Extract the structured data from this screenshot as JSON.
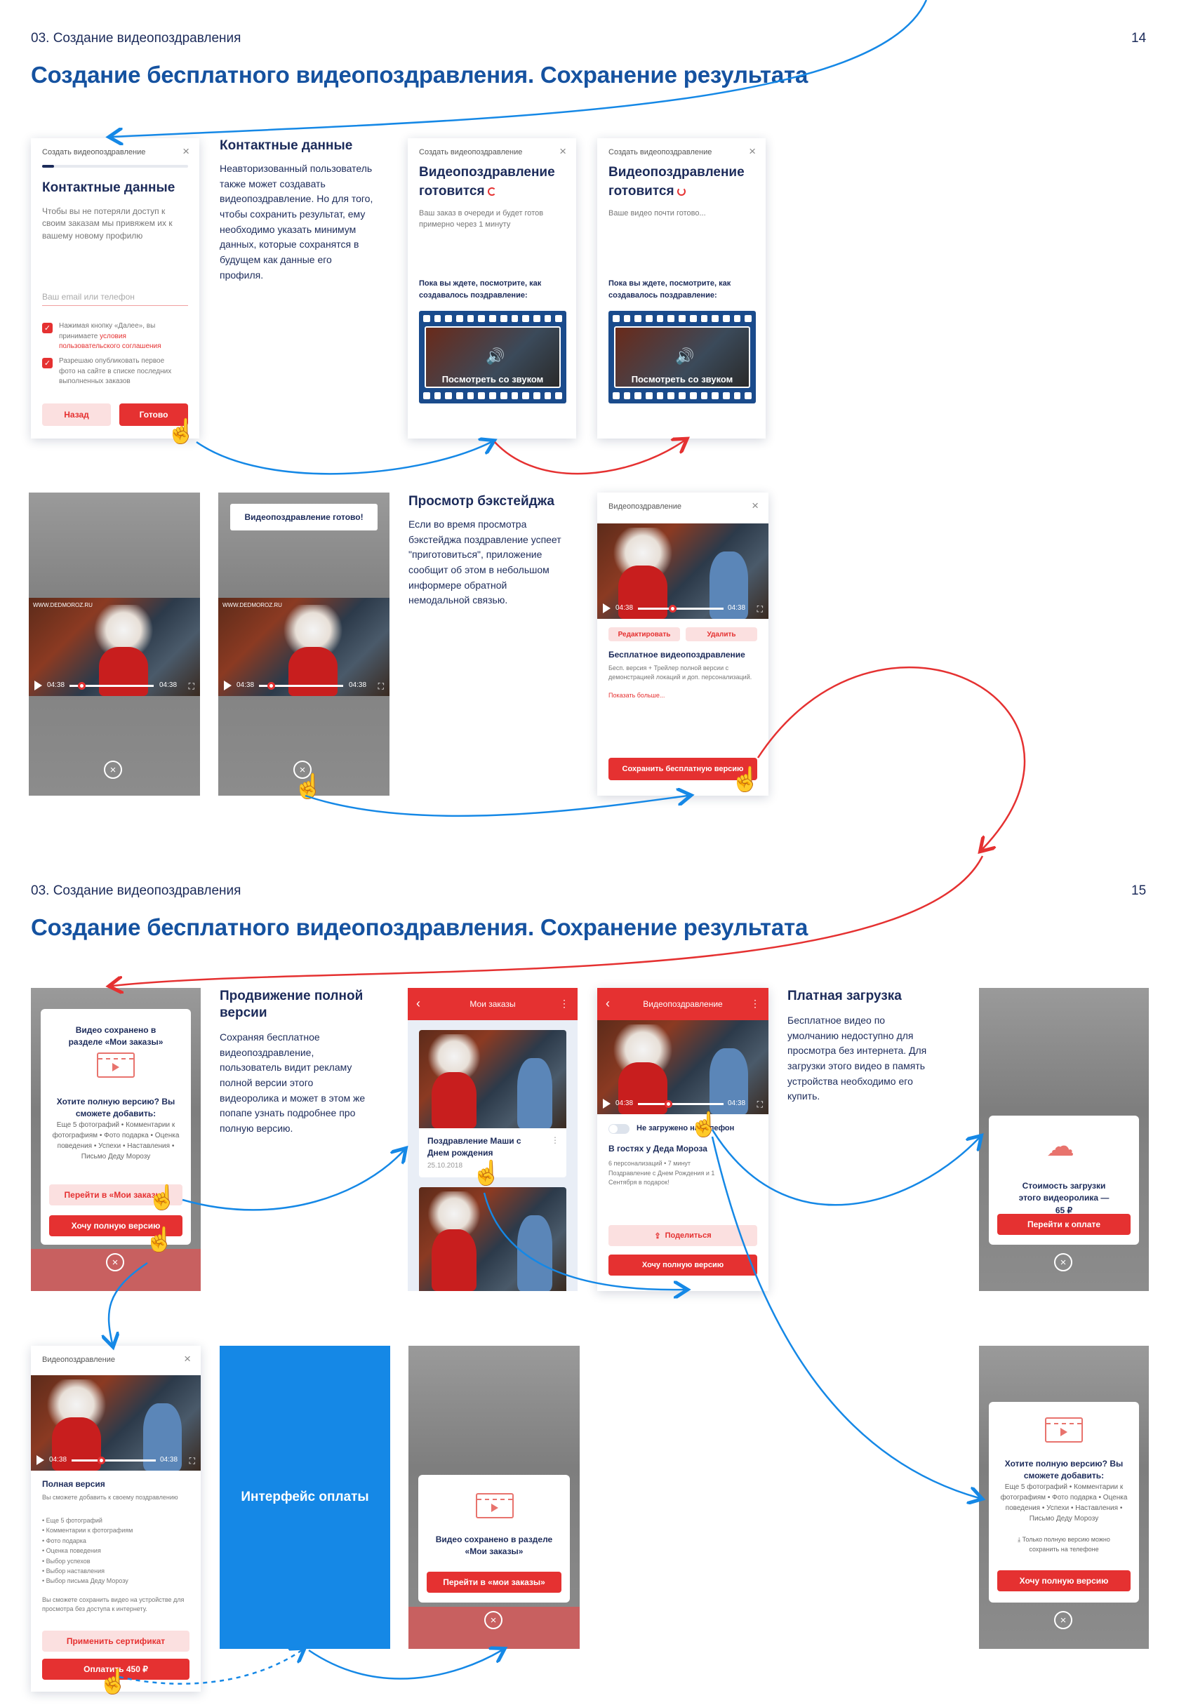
{
  "page14": {
    "breadcrumb": "03. Создание видеопоздравления",
    "page_number": "14",
    "title": "Создание бесплатного видеопоздравления. Сохранение результата"
  },
  "page15": {
    "breadcrumb": "03. Создание видеопоздравления",
    "page_number": "15",
    "title": "Создание бесплатного видеопоздравления. Сохранение результата"
  },
  "contacts_screen": {
    "header": "Создать видеопоздравление",
    "close": "×",
    "progress": 0.08,
    "title": "Контактные данные",
    "subtitle": "Чтобы вы не потеряли доступ к своим заказам мы привяжем их к вашему новому профилю",
    "input_placeholder": "Ваш email или телефон",
    "check1_text": "Нажимая кнопку «Далее», вы принимаете",
    "check1_link": "условия пользовательского соглашения",
    "check2_text": "Разрешаю опубликовать первое фото на сайте в списке последних выполненных заказов",
    "back_button": "Назад",
    "done_button": "Готово"
  },
  "contacts_annotation": {
    "title": "Контактные данные",
    "text": "Неавторизованный пользователь также может создавать видеопоздравление. Но для того, чтобы сохранить результат, ему необходимо указать минимум данных, которые сохранятся в будущем как данные его профиля."
  },
  "preparing1": {
    "header": "Создать видеопоздравление",
    "close": "×",
    "title": "Видеопоздравление готовится",
    "subtitle": "Ваш заказ в очереди и будет готов примерно через 1 минуту",
    "watch_label": "Пока вы ждете, посмотрите, как создавалось поздравление:",
    "film_text": "Посмотреть со звуком"
  },
  "preparing2": {
    "header": "Создать видеопоздравление",
    "close": "×",
    "title": "Видеопоздравление готовится",
    "subtitle": "Ваше видео почти готово...",
    "watch_label": "Пока вы ждете, посмотрите, как создавалось поздравление:",
    "film_text": "Посмотреть со звуком"
  },
  "backstage_player": {
    "watermark": "WWW.DEDMOROZ.RU",
    "time_left": "04:38",
    "time_right": "04:38",
    "progress": 0.14,
    "close": "×"
  },
  "backstage_ready": {
    "toast": "Видеопоздравление готово!",
    "watermark": "WWW.DEDMOROZ.RU",
    "time_left": "04:38",
    "time_right": "04:38",
    "progress": 0.14,
    "close": "×"
  },
  "backstage_annotation": {
    "title": "Просмотр бэкстейджа",
    "text": "Если во время просмотра бэкстейджа поздравление успеет \"приготовиться\", приложение сообщит об этом в небольшом информере обратной немодальной связью."
  },
  "video_card": {
    "header": "Видеопоздравление",
    "close": "×",
    "time_left": "04:38",
    "time_right": "04:38",
    "progress": 0.4,
    "edit_button": "Редактировать",
    "delete_button": "Удалить",
    "title": "Бесплатное видеопоздравление",
    "description": "Бесп. версия + Трейлер полной версии с демонстрацией локаций и доп. персонализаций.",
    "more_link": "Показать больше...",
    "save_button": "Сохранить бесплатную версию"
  },
  "saved_popup": {
    "title": "Видео сохранено в разделе «Мои заказы»",
    "question": "Хотите полную версию? Вы сможете добавить:",
    "features": "Еще 5 фотографий • Комментарии к фотографиям • Фото подарка • Оценка поведения • Успехи • Наставления • Письмо Деду Морозу",
    "goto_button": "Перейти в «Мои заказы»",
    "full_button": "Хочу полную версию",
    "close": "×"
  },
  "promo_annotation": {
    "title": "Продвижение полной версии",
    "text": "Сохраняя бесплатное видеопоздравление, пользователь видит рекламу полной версии этого видеоролика и может в этом же попапе узнать подробнее про полную версию."
  },
  "my_orders": {
    "back": "‹",
    "title": "Мои заказы",
    "menu": "⋮",
    "card_title": "Поздравление Маши с Днем рождения",
    "card_date": "25.10.2018",
    "card_menu": "⋮"
  },
  "video_detail": {
    "back": "‹",
    "title": "Видеопоздравление",
    "menu": "⋮",
    "time_left": "04:38",
    "time_right": "04:38",
    "progress": 0.35,
    "toggle_label": "Не загружено на телефон",
    "name": "В гостях у Деда Мороза",
    "meta": "6 персонализаций • 7 минут",
    "desc": "Поздравление с Днем Рождения и 1 Сентября в подарок!",
    "share_button": "Поделиться",
    "full_button": "Хочу полную версию"
  },
  "paid_annotation": {
    "title": "Платная загрузка",
    "text": "Бесплатное видео по умолчанию недоступно для просмотра без интернета. Для загрузки этого видео в память устройства необходимо его купить."
  },
  "download_popup": {
    "text": "Стоимость загрузки этого видеоролика — 65 ₽",
    "button": "Перейти к оплате",
    "close": "×"
  },
  "full_version_card": {
    "header": "Видеопоздравление",
    "close": "×",
    "time_left": "04:38",
    "time_right": "04:38",
    "progress": 0.35,
    "title": "Полная версия",
    "intro": "Вы сможете добавить к своему поздравлению",
    "items": [
      "Еще 5 фотографий",
      "Комментарии к фотографиям",
      "Фото подарка",
      "Оценка поведения",
      "Выбор успехов",
      "Выбор наставления",
      "Выбор письма Деду Морозу"
    ],
    "outro": "Вы сможете сохранить видео на устройстве для просмотра без доступа к интернету.",
    "cert_button": "Применить сертификат",
    "pay_button": "Оплатить 450 ₽"
  },
  "payment_panel": {
    "label": "Интерфейс оплаты"
  },
  "saved_popup2": {
    "title": "Видео сохранено в разделе «Мои заказы»",
    "button": "Перейти в «мои заказы»",
    "close": "×"
  },
  "full_popup2": {
    "question": "Хотите полную версию? Вы сможете добавить:",
    "features": "Еще 5 фотографий • Комментарии к фотографиям • Фото подарка • Оценка поведения • Успехи • Наставления • Письмо Деду Морозу",
    "note": "Только полную версию можно сохранить на телефоне",
    "button": "Хочу полную версию",
    "close": "×"
  },
  "colors": {
    "accent_red": "#e53131",
    "accent_blue": "#1588e6",
    "title_blue": "#1552a0",
    "text_dark": "#1c2b5a"
  }
}
